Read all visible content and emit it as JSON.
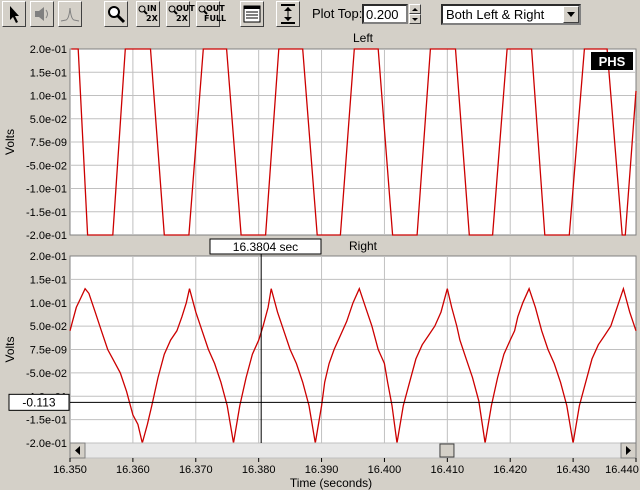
{
  "toolbar": {
    "zoom_in_label": "IN",
    "zoom_in_factor": "2X",
    "zoom_out_label": "OUT",
    "zoom_out_factor": "2X",
    "zoom_full_label": "OUT",
    "zoom_full_factor": "FULL",
    "plot_top_label": "Plot Top:",
    "plot_top_value": "0.200",
    "channel_select": "Both Left & Right"
  },
  "logo_text": "PHS",
  "cursor": {
    "time_readout": "16.3804 sec",
    "value_readout": "-0.113",
    "time": 16.3804,
    "value": -0.113
  },
  "scrollbar": {
    "position_fraction": 0.68
  },
  "chart_data": [
    {
      "type": "line",
      "title": "Left",
      "ylabel": "Volts",
      "xlabel": "",
      "ytick_labels": [
        "2.0e-01",
        "1.5e-01",
        "1.0e-01",
        "5.0e-02",
        "7.5e-09",
        "-5.0e-02",
        "-1.0e-01",
        "-1.5e-01",
        "-2.0e-01"
      ],
      "ylim": [
        -0.2,
        0.2
      ],
      "xlim": [
        16.35,
        16.44
      ],
      "grid": true,
      "series": [
        {
          "color": "#cc0000",
          "x": [
            16.3502,
            16.3508,
            16.3513,
            16.3528,
            16.3534,
            16.3562,
            16.3568,
            16.3588,
            16.3593,
            16.3622,
            16.3628,
            16.365,
            16.3654,
            16.3683,
            16.3689,
            16.3712,
            16.3715,
            16.3744,
            16.3749,
            16.3772,
            16.3777,
            16.3805,
            16.3811,
            16.3832,
            16.3837,
            16.3864,
            16.387,
            16.3893,
            16.3897,
            16.3925,
            16.393,
            16.3952,
            16.3958,
            16.3985,
            16.399,
            16.4013,
            16.4019,
            16.4046,
            16.4052,
            16.4073,
            16.408,
            16.4107,
            16.4113,
            16.4135,
            16.414,
            16.4167,
            16.4172,
            16.4195,
            16.42,
            16.4228,
            16.4234,
            16.4255,
            16.4262,
            16.4288,
            16.4294,
            16.4318,
            16.4321,
            16.4348,
            16.4354,
            16.4378,
            16.4383,
            16.44
          ],
          "y": [
            0.2,
            0.2,
            0.2,
            -0.2,
            -0.2,
            -0.2,
            -0.2,
            0.2,
            0.2,
            0.2,
            0.2,
            -0.2,
            -0.2,
            -0.2,
            -0.2,
            0.2,
            0.2,
            0.2,
            0.2,
            -0.2,
            -0.2,
            -0.2,
            -0.2,
            0.2,
            0.2,
            0.2,
            0.2,
            -0.2,
            -0.2,
            -0.2,
            -0.2,
            0.2,
            0.2,
            0.2,
            0.2,
            -0.2,
            -0.2,
            -0.2,
            -0.2,
            0.2,
            0.2,
            0.2,
            0.2,
            -0.2,
            -0.2,
            -0.2,
            -0.2,
            0.2,
            0.2,
            0.2,
            0.2,
            -0.2,
            -0.2,
            -0.2,
            -0.2,
            0.2,
            0.2,
            0.2,
            0.2,
            -0.2,
            -0.2,
            0.11
          ]
        }
      ]
    },
    {
      "type": "line",
      "title": "Right",
      "ylabel": "Volts",
      "xlabel": "Time (seconds)",
      "ytick_labels": [
        "2.0e-01",
        "1.5e-01",
        "1.0e-01",
        "5.0e-02",
        "7.5e-09",
        "-5.0e-02",
        "-1.0e-01",
        "-1.5e-01",
        "-2.0e-01"
      ],
      "xtick_labels": [
        "16.350",
        "16.360",
        "16.370",
        "16.380",
        "16.390",
        "16.400",
        "16.410",
        "16.420",
        "16.430",
        "16.440"
      ],
      "ylim": [
        -0.2,
        0.2
      ],
      "xlim": [
        16.35,
        16.44
      ],
      "grid": true,
      "series": [
        {
          "color": "#cc0000",
          "x": [
            16.35,
            16.3504,
            16.351,
            16.3517,
            16.3524,
            16.353,
            16.354,
            16.355,
            16.356,
            16.3568,
            16.358,
            16.359,
            16.36,
            16.3608,
            16.3615,
            16.3623,
            16.363,
            16.364,
            16.365,
            16.366,
            16.367,
            16.3678,
            16.3685,
            16.369,
            16.37,
            16.371,
            16.372,
            16.373,
            16.374,
            16.375,
            16.376,
            16.377,
            16.378,
            16.379,
            16.38,
            16.3807,
            16.3815,
            16.382,
            16.383,
            16.384,
            16.385,
            16.386,
            16.387,
            16.388,
            16.389,
            16.39,
            16.3905,
            16.3912,
            16.392,
            16.393,
            16.394,
            16.395,
            16.396,
            16.397,
            16.398,
            16.399,
            16.4,
            16.4005,
            16.4012,
            16.402,
            16.403,
            16.404,
            16.405,
            16.406,
            16.407,
            16.408,
            16.409,
            16.41,
            16.4107,
            16.4115,
            16.412,
            16.413,
            16.414,
            16.415,
            16.416,
            16.417,
            16.418,
            16.419,
            16.42,
            16.4207,
            16.4212,
            16.422,
            16.423,
            16.424,
            16.425,
            16.426,
            16.427,
            16.428,
            16.429,
            16.43,
            16.431,
            16.432,
            16.433,
            16.434,
            16.435,
            16.436,
            16.437,
            16.438,
            16.439,
            16.44
          ],
          "y": [
            0.04,
            0.06,
            0.09,
            0.11,
            0.13,
            0.12,
            0.08,
            0.04,
            0.0,
            -0.02,
            -0.05,
            -0.09,
            -0.14,
            -0.16,
            -0.2,
            -0.16,
            -0.12,
            -0.06,
            -0.01,
            0.02,
            0.04,
            0.07,
            0.1,
            0.13,
            0.08,
            0.04,
            0.0,
            -0.03,
            -0.07,
            -0.12,
            -0.2,
            -0.12,
            -0.06,
            -0.01,
            0.02,
            0.05,
            0.09,
            0.13,
            0.08,
            0.04,
            0.0,
            -0.03,
            -0.07,
            -0.12,
            -0.2,
            -0.12,
            -0.07,
            -0.03,
            0.0,
            0.03,
            0.06,
            0.1,
            0.13,
            0.09,
            0.05,
            0.0,
            -0.03,
            -0.07,
            -0.12,
            -0.2,
            -0.12,
            -0.07,
            -0.02,
            0.01,
            0.03,
            0.05,
            0.08,
            0.13,
            0.09,
            0.05,
            0.02,
            -0.02,
            -0.06,
            -0.11,
            -0.2,
            -0.12,
            -0.06,
            -0.01,
            0.02,
            0.04,
            0.07,
            0.1,
            0.13,
            0.09,
            0.04,
            0.0,
            -0.03,
            -0.07,
            -0.12,
            -0.2,
            -0.12,
            -0.07,
            -0.02,
            0.01,
            0.03,
            0.05,
            0.09,
            0.13,
            0.08,
            0.04
          ]
        }
      ]
    }
  ]
}
